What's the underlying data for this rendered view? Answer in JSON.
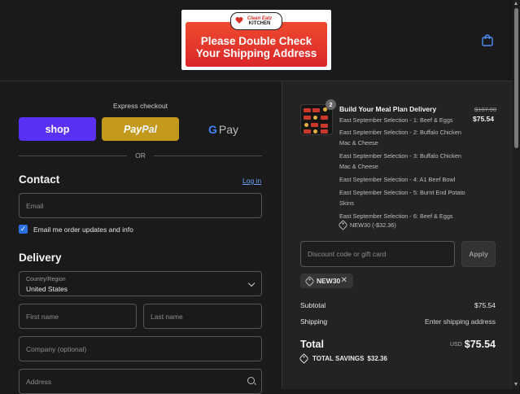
{
  "header": {
    "logo": {
      "brand": "Clean Eatz",
      "kitchen": "KITCHEN",
      "banner_line1": "Please Double Check",
      "banner_line2": "Your Shipping Address"
    },
    "cart_icon": "shopping-bag-icon"
  },
  "express": {
    "title": "Express checkout",
    "shop_label": "shop",
    "paypal_pay": "Pay",
    "paypal_pal": "Pal",
    "gpay_g": "G",
    "gpay_label": "Pay",
    "or_label": "OR"
  },
  "contact": {
    "heading": "Contact",
    "login_link": "Log in",
    "email_placeholder": "Email",
    "email_updates_label": "Email me order updates and info",
    "email_updates_checked": true
  },
  "delivery": {
    "heading": "Delivery",
    "country_label": "Country/Region",
    "country_value": "United States",
    "first_name_placeholder": "First name",
    "last_name_placeholder": "Last name",
    "company_placeholder": "Company (optional)",
    "address_placeholder": "Address"
  },
  "summary": {
    "product": {
      "title": "Build Your Meal Plan Delivery",
      "quantity": "2",
      "price_original": "$107.90",
      "price_current": "$75.54",
      "selections": [
        "East September Selection - 1: Beef & Eggs",
        "East September Selection - 2: Buffalo Chicken Mac & Cheese",
        "East September Selection - 3: Buffalo Chicken Mac & Cheese",
        "East September Selection - 4: A1 Beef Bowl",
        "East September Selection - 5: Burnt End Potato Skins",
        "East September Selection - 6: Beef & Eggs"
      ],
      "discount_line": "NEW30 (-$32.36)"
    },
    "discount_placeholder": "Discount code or gift card",
    "apply_label": "Apply",
    "applied_code": "NEW30",
    "subtotal_label": "Subtotal",
    "subtotal_value": "$75.54",
    "shipping_label": "Shipping",
    "shipping_value": "Enter shipping address",
    "total_label": "Total",
    "total_currency": "USD",
    "total_value": "$75.54",
    "savings_label": "TOTAL SAVINGS",
    "savings_value": "$32.36"
  },
  "colors": {
    "shop_pay": "#5a31f4",
    "paypal": "#c49a1c",
    "link": "#6fa4ff",
    "checkbox": "#2a6fe0",
    "banner_red": "#e0352b"
  }
}
